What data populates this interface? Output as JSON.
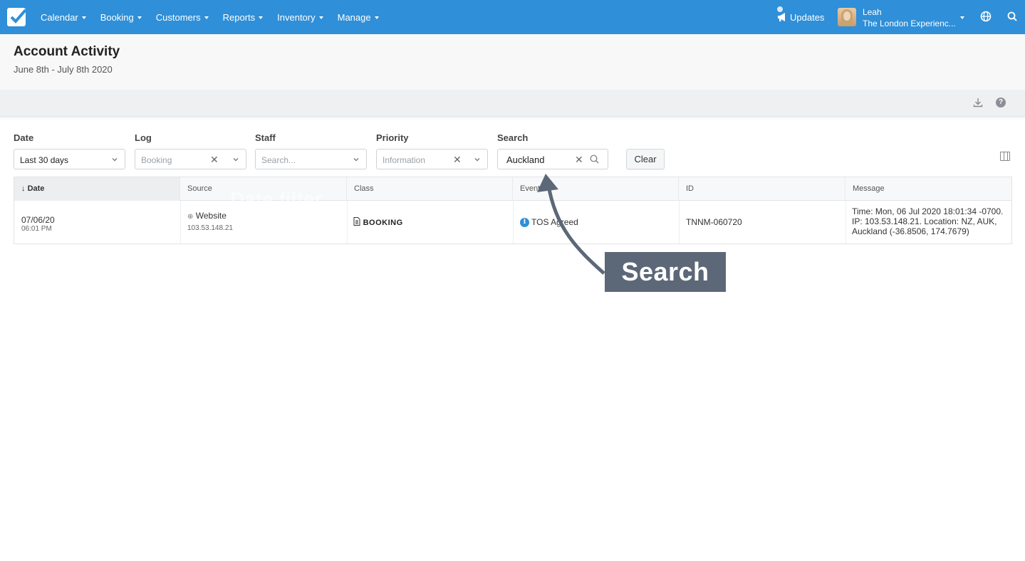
{
  "nav": {
    "items": [
      "Calendar",
      "Booking",
      "Customers",
      "Reports",
      "Inventory",
      "Manage"
    ],
    "updates_label": "Updates",
    "user_name": "Leah",
    "company": "The London Experienc..."
  },
  "page": {
    "title": "Account Activity",
    "subtitle": "June 8th - July 8th 2020"
  },
  "filters": {
    "date": {
      "label": "Date",
      "value": "Last 30 days"
    },
    "log": {
      "label": "Log",
      "value": "Booking"
    },
    "staff": {
      "label": "Staff",
      "placeholder": "Search..."
    },
    "priority": {
      "label": "Priority",
      "value": "Information"
    },
    "search": {
      "label": "Search",
      "value": "Auckland"
    },
    "clear_label": "Clear"
  },
  "table": {
    "columns": [
      "Date",
      "Source",
      "Class",
      "Event",
      "ID",
      "Message"
    ],
    "rows": [
      {
        "date": "07/06/20",
        "time": "06:01 PM",
        "source": "Website",
        "ip": "103.53.148.21",
        "class": "BOOKING",
        "event": "TOS Agreed",
        "id": "TNNM-060720",
        "message": "Time: Mon, 06 Jul 2020 18:01:34 -0700. IP: 103.53.148.21. Location: NZ, AUK, Auckland (-36.8506, 174.7679)"
      }
    ]
  },
  "annotation": {
    "callout": "Search",
    "ghost_text": "Date filter"
  },
  "colors": {
    "nav_bg": "#2f8fd8",
    "callout_bg": "#5c6878",
    "info_icon": "#2f8fd8"
  }
}
